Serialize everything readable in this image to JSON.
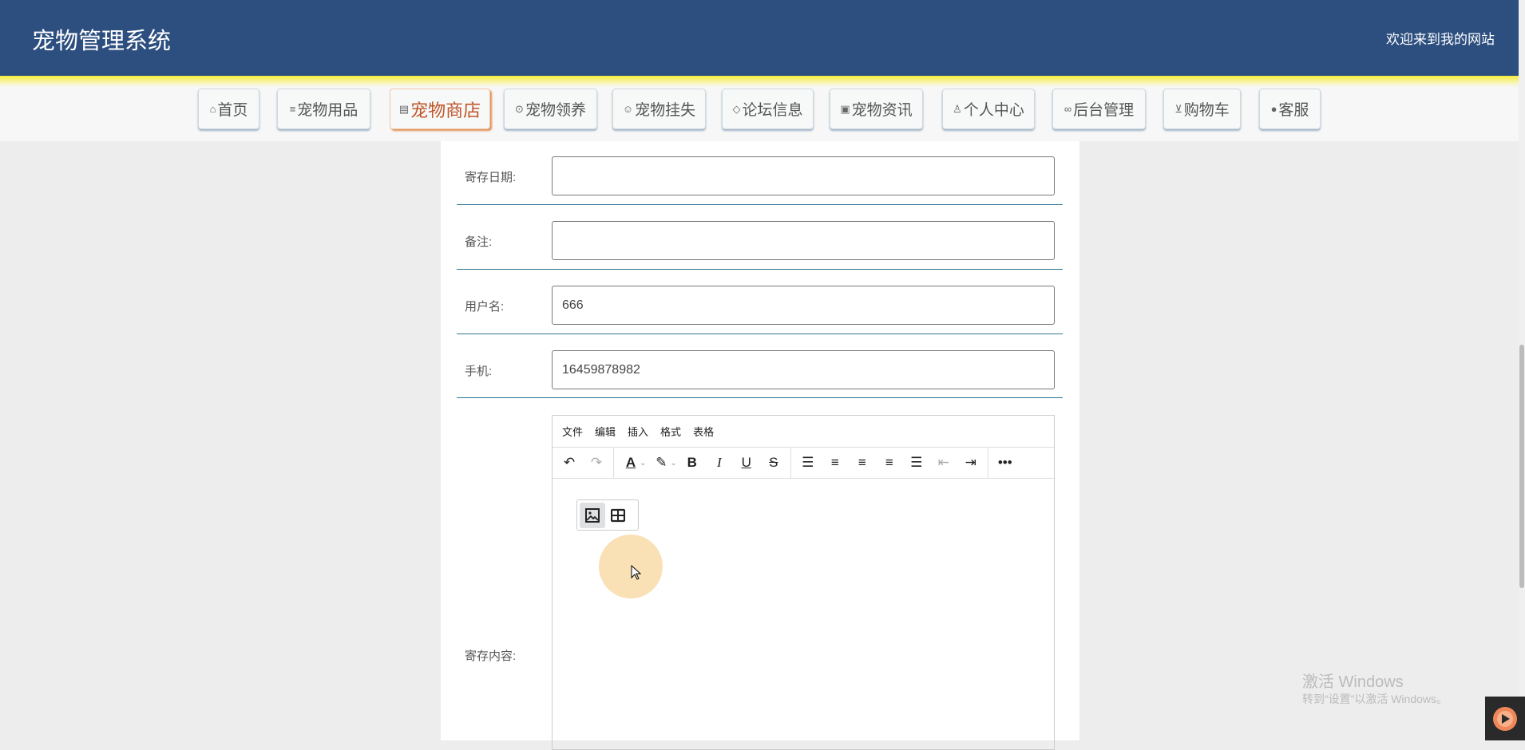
{
  "header": {
    "title": "宠物管理系统",
    "welcome": "欢迎来到我的网站"
  },
  "nav": [
    {
      "label": "首页",
      "icon": "⌂"
    },
    {
      "label": "宠物用品",
      "icon": "≡"
    },
    {
      "label": "宠物商店",
      "icon": "▤"
    },
    {
      "label": "宠物领养",
      "icon": "⊙"
    },
    {
      "label": "宠物挂失",
      "icon": "☺"
    },
    {
      "label": "论坛信息",
      "icon": "◇"
    },
    {
      "label": "宠物资讯",
      "icon": "▣"
    },
    {
      "label": "个人中心",
      "icon": "♙"
    },
    {
      "label": "后台管理",
      "icon": "∞"
    },
    {
      "label": "购物车",
      "icon": "⊻"
    },
    {
      "label": "客服",
      "icon": "●"
    }
  ],
  "form": {
    "date_label": "寄存日期:",
    "date_value": "",
    "note_label": "备注:",
    "note_value": "",
    "username_label": "用户名:",
    "username_value": "666",
    "phone_label": "手机:",
    "phone_value": "16459878982",
    "content_label": "寄存内容:"
  },
  "editor": {
    "menu": [
      "文件",
      "编辑",
      "插入",
      "格式",
      "表格"
    ]
  },
  "watermark": {
    "line1": "激活 Windows",
    "line2": "转到“设置”以激活 Windows。"
  }
}
